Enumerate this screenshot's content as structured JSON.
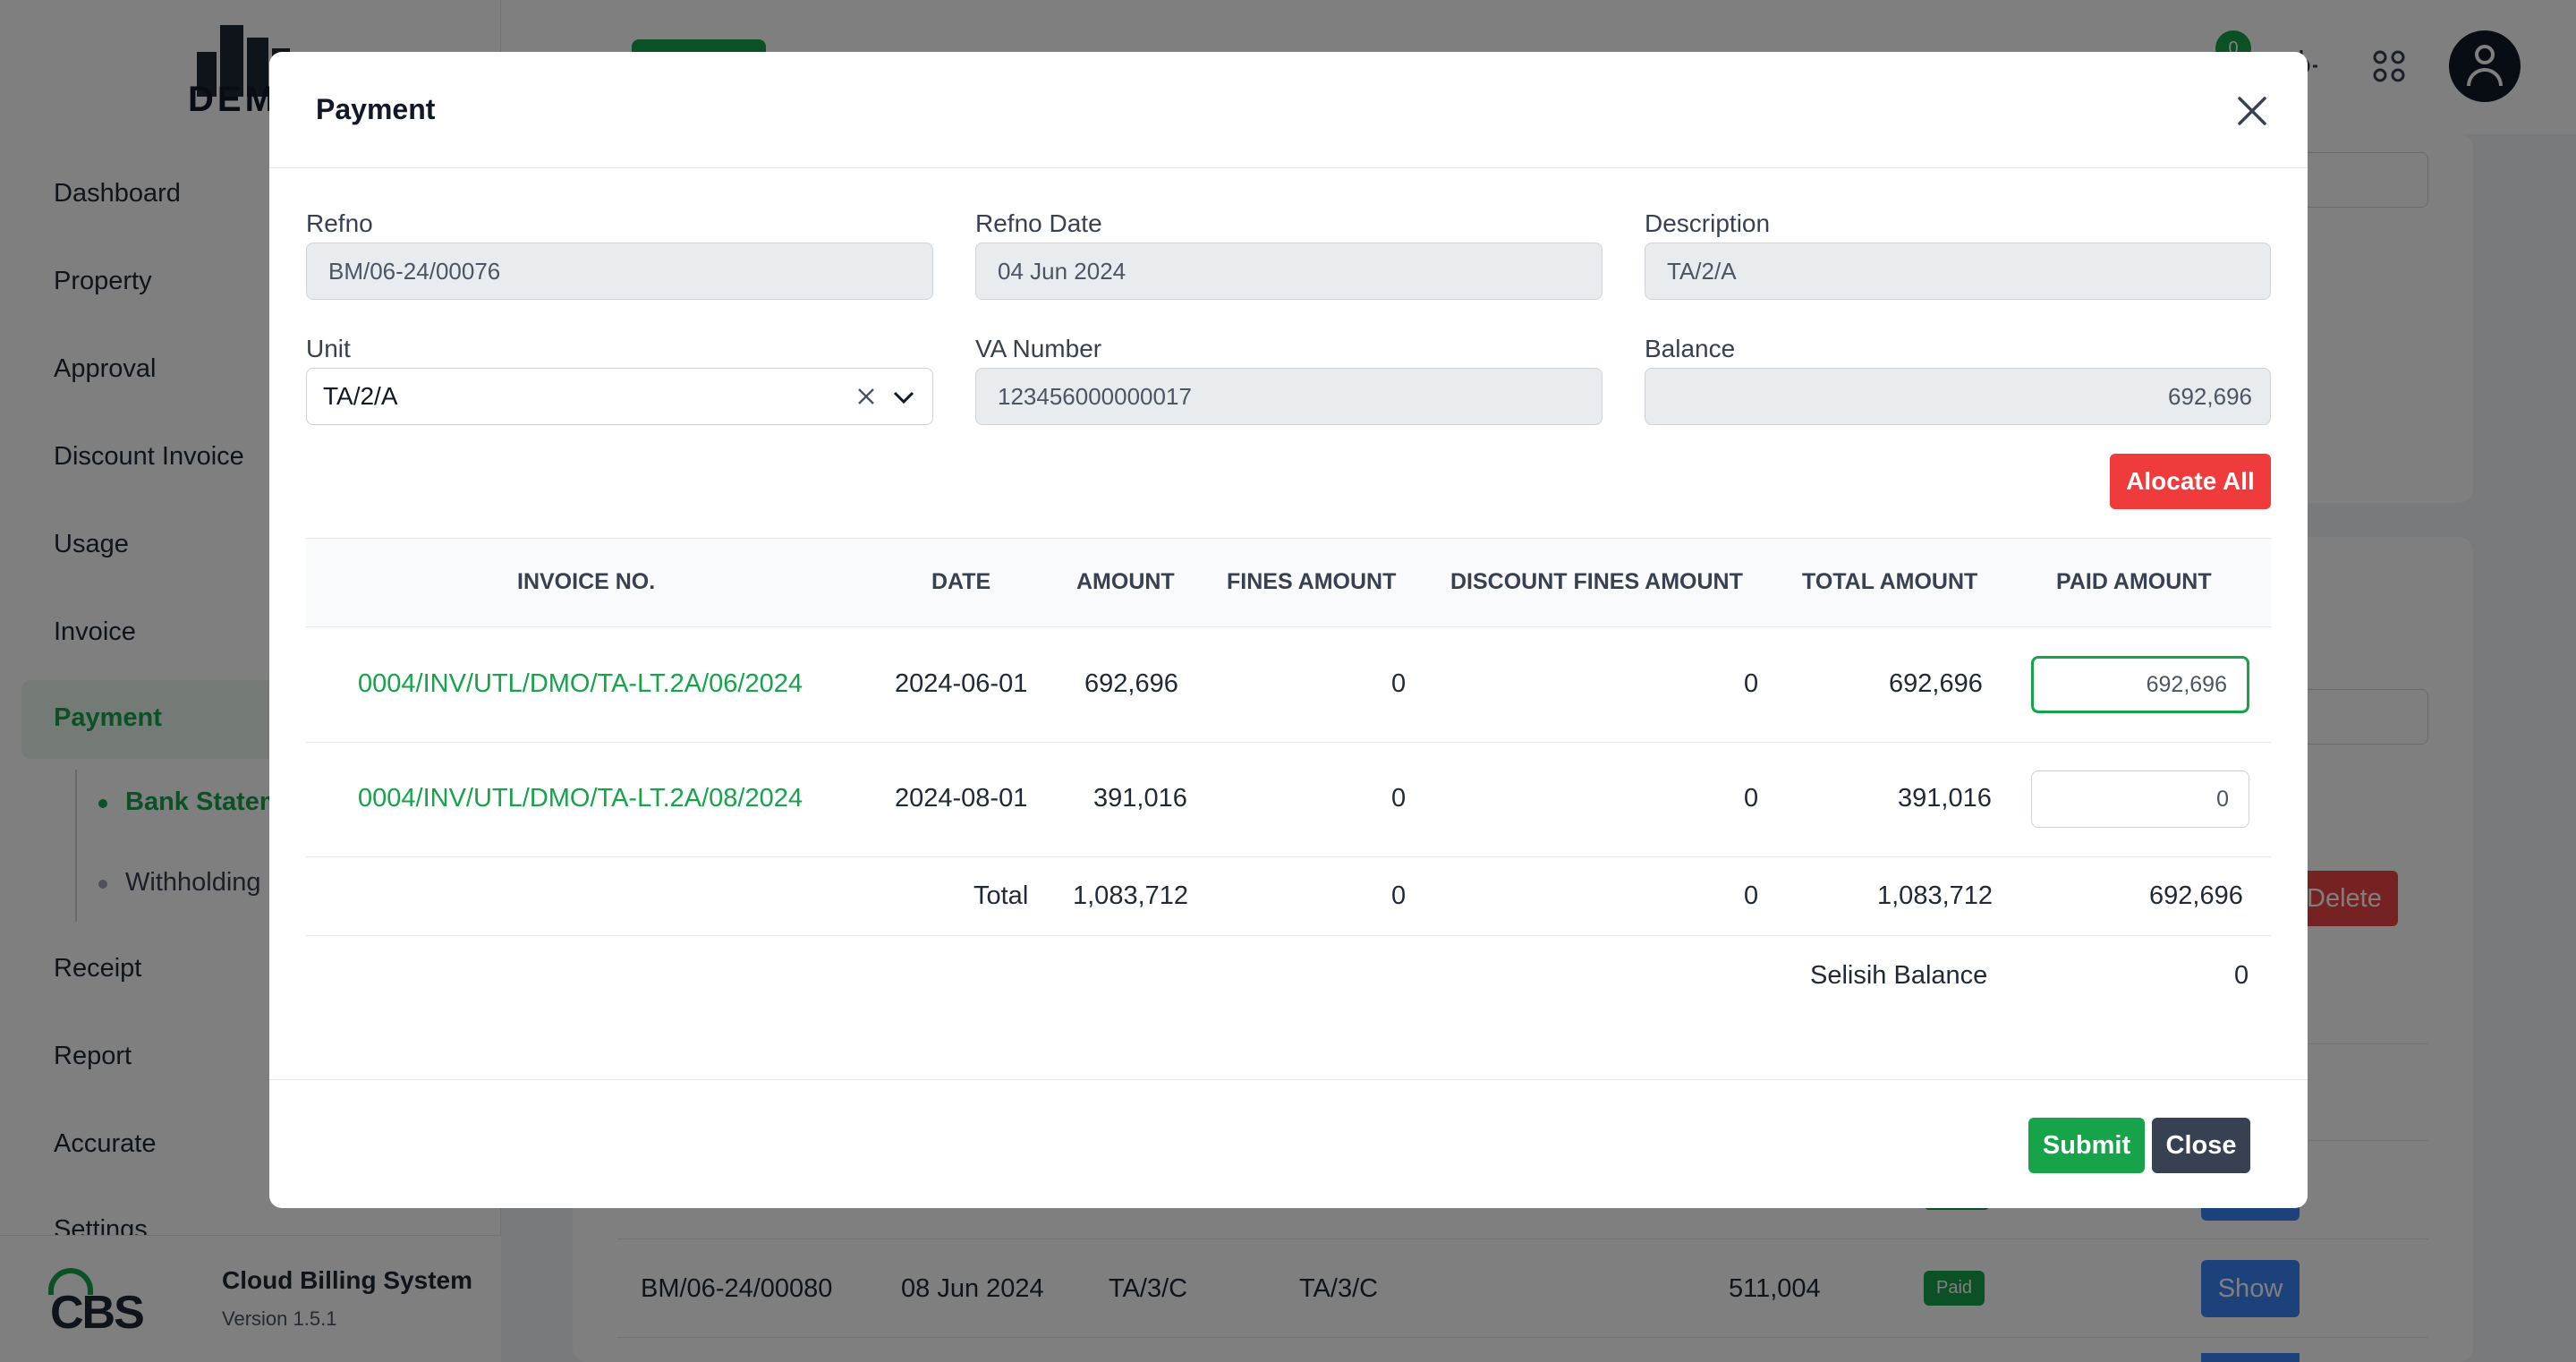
{
  "sidebar": {
    "logo_text": "DEM",
    "items": [
      {
        "label": "Dashboard"
      },
      {
        "label": "Property"
      },
      {
        "label": "Approval"
      },
      {
        "label": "Discount Invoice"
      },
      {
        "label": "Usage"
      },
      {
        "label": "Invoice"
      },
      {
        "label": "Payment"
      },
      {
        "label": "Receipt"
      },
      {
        "label": "Report"
      },
      {
        "label": "Accurate"
      },
      {
        "label": "Settings"
      }
    ],
    "subitems": [
      {
        "label": "Bank Statem"
      },
      {
        "label": "Withholding"
      }
    ],
    "footer": {
      "app_name": "Cloud Billing System",
      "version": "Version 1.5.1",
      "logo_text": "CBS"
    }
  },
  "topbar": {
    "notification_count": "0"
  },
  "background_table": {
    "row": {
      "ref": "BM/06-24/00080",
      "date": "08 Jun 2024",
      "unit": "TA/3/C",
      "description": "TA/3/C",
      "amount": "511,004",
      "status": "Paid",
      "action": "Show"
    },
    "delete_label": "Delete"
  },
  "modal": {
    "title": "Payment",
    "fields": {
      "refno": {
        "label": "Refno",
        "value": "BM/06-24/00076"
      },
      "refno_date": {
        "label": "Refno Date",
        "value": "04 Jun 2024"
      },
      "description": {
        "label": "Description",
        "value": "TA/2/A"
      },
      "unit": {
        "label": "Unit",
        "value": "TA/2/A"
      },
      "va_number": {
        "label": "VA Number",
        "value": "123456000000017"
      },
      "balance": {
        "label": "Balance",
        "value": "692,696"
      }
    },
    "allocate_all_label": "Alocate All",
    "table": {
      "headers": [
        "INVOICE NO.",
        "DATE",
        "AMOUNT",
        "FINES AMOUNT",
        "DISCOUNT FINES AMOUNT",
        "TOTAL AMOUNT",
        "PAID AMOUNT"
      ],
      "rows": [
        {
          "invoice_no": "0004/INV/UTL/DMO/TA-LT.2A/06/2024",
          "date": "2024-06-01",
          "amount": "692,696",
          "fines": "0",
          "discount_fines": "0",
          "total": "692,696",
          "paid": "692,696"
        },
        {
          "invoice_no": "0004/INV/UTL/DMO/TA-LT.2A/08/2024",
          "date": "2024-08-01",
          "amount": "391,016",
          "fines": "0",
          "discount_fines": "0",
          "total": "391,016",
          "paid": "0"
        }
      ],
      "total": {
        "label": "Total",
        "amount": "1,083,712",
        "fines": "0",
        "discount_fines": "0",
        "total": "1,083,712",
        "paid": "692,696"
      },
      "selisih": {
        "label": "Selisih Balance",
        "value": "0"
      }
    },
    "submit_label": "Submit",
    "close_label": "Close"
  },
  "colors": {
    "accent": "#16a34a",
    "danger": "#ef3b3b",
    "dark_button": "#374151"
  }
}
